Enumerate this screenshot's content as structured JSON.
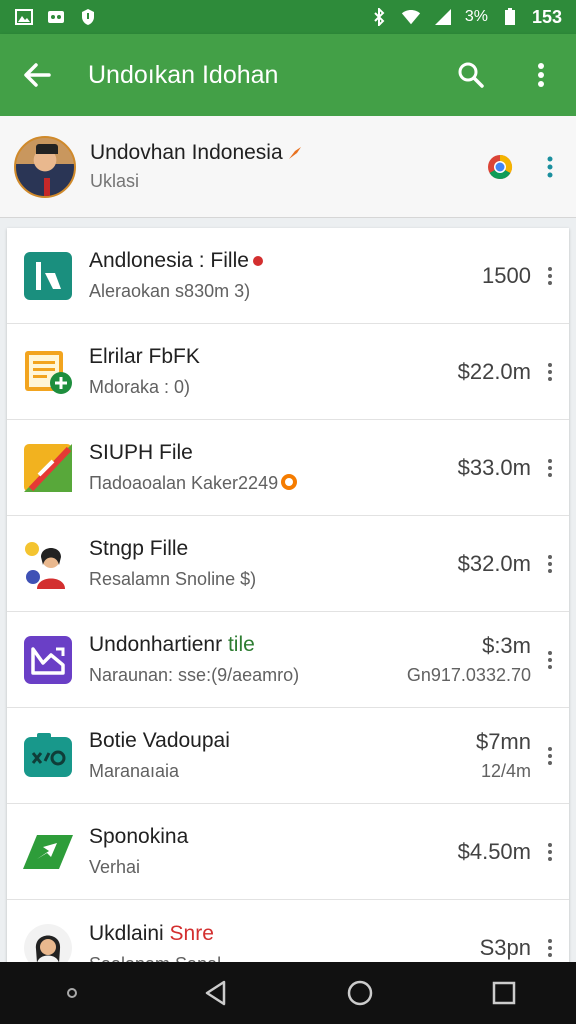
{
  "status_bar": {
    "battery_percent": "3%",
    "time": "153",
    "icons": [
      "gallery-icon",
      "photo-icon",
      "shield-icon",
      "bluetooth-icon",
      "wifi-icon",
      "signal-icon",
      "battery-icon"
    ]
  },
  "app_bar": {
    "title": "Undoıkan Idohan",
    "icons": [
      "back-arrow-icon",
      "search-icon",
      "more-vert-icon"
    ]
  },
  "profile": {
    "name": "Undovhan Indonesia",
    "subtitle": "Uklasi",
    "icons": [
      "chrome-icon",
      "more-vert-icon"
    ]
  },
  "items": [
    {
      "title": "Andlonesia : Fille",
      "subtitle": "Aleraokan s830m 3)",
      "amount": "1500",
      "amount2": "",
      "icon": "app-k-icon",
      "color": "#1a8f7e"
    },
    {
      "title": "Elrilar FbFK",
      "subtitle": "Mdoraka : 0)",
      "amount": "$22.0m",
      "amount2": "",
      "icon": "document-add-icon",
      "color": "#f2a41f"
    },
    {
      "title": "SIUPH File",
      "subtitle": "Пadoaoalan Kaker2249",
      "amount": "$33.0m",
      "amount2": "",
      "icon": "pencil-slash-icon",
      "color": "#f2b21f"
    },
    {
      "title": "Stngp Fille",
      "subtitle": "Resalamn Snoline $)",
      "amount": "$32.0m",
      "amount2": "",
      "icon": "person-avatar-icon",
      "color": "#d32f2f"
    },
    {
      "title": "Undonhartienr",
      "title_tag": "tile",
      "subtitle": "Naraunan: sse:(9/aeamro)",
      "amount": "$:3m",
      "amount2": "Gn917.0332.70",
      "icon": "mail-chart-icon",
      "color": "#6a3fc6"
    },
    {
      "title": "Botie Vadoupai",
      "subtitle": "Maranaıaia",
      "amount": "$7mn",
      "amount2": "12/4m",
      "icon": "camera-code-icon",
      "color": "#18988b"
    },
    {
      "title": "Sponokina",
      "subtitle": "Verhai",
      "amount": "$4.50m",
      "amount2": "",
      "icon": "paper-plane-icon",
      "color": "#2e9d3a"
    },
    {
      "title": "Ukdlaini",
      "title_tag": "Snre",
      "subtitle": "Saalanam Sanal",
      "amount": "S3pn",
      "amount2": "",
      "icon": "person-avatar-icon",
      "color": "#333333"
    }
  ],
  "nav_bar": {
    "icons": [
      "dot-icon",
      "back-triangle-icon",
      "home-circle-icon",
      "recents-square-icon"
    ]
  }
}
